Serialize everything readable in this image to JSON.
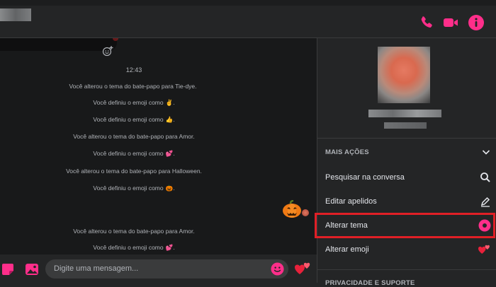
{
  "header": {
    "icons": [
      "phone-icon",
      "video-camera-icon",
      "info-icon"
    ],
    "accent_color": "#ff2e8a"
  },
  "chat": {
    "time": "12:43",
    "messages": [
      {
        "text": "Você alterou o tema do bate-papo para Tie-dye.",
        "emoji": ""
      },
      {
        "text": "Você definiu o emoji como",
        "emoji": "✌️"
      },
      {
        "text": "Você definiu o emoji como",
        "emoji": "👍"
      },
      {
        "text": "Você alterou o tema do bate-papo para Amor.",
        "emoji": ""
      },
      {
        "text": "Você definiu o emoji como",
        "emoji": "💕"
      },
      {
        "text": "Você alterou o tema do bate-papo para Halloween.",
        "emoji": ""
      },
      {
        "text": "Você definiu o emoji como",
        "emoji": "🎃"
      },
      {
        "text": "Você alterou o tema do bate-papo para Amor.",
        "emoji": ""
      },
      {
        "text": "Você definiu o emoji como",
        "emoji": "💕"
      }
    ],
    "big_emoji": "🎃"
  },
  "composer": {
    "placeholder": "Digite uma mensagem...",
    "send_emoji": "💕"
  },
  "panel": {
    "section_more_actions": "MAIS AÇÕES",
    "actions": [
      {
        "label": "Pesquisar na conversa",
        "icon": "search-icon"
      },
      {
        "label": "Editar apelidos",
        "icon": "pencil-icon"
      },
      {
        "label": "Alterar tema",
        "icon": "theme-circle-icon"
      },
      {
        "label": "Alterar emoji",
        "icon": "hearts-icon",
        "emoji": "💕"
      }
    ],
    "section_privacy": "PRIVACIDADE E SUPORTE"
  }
}
